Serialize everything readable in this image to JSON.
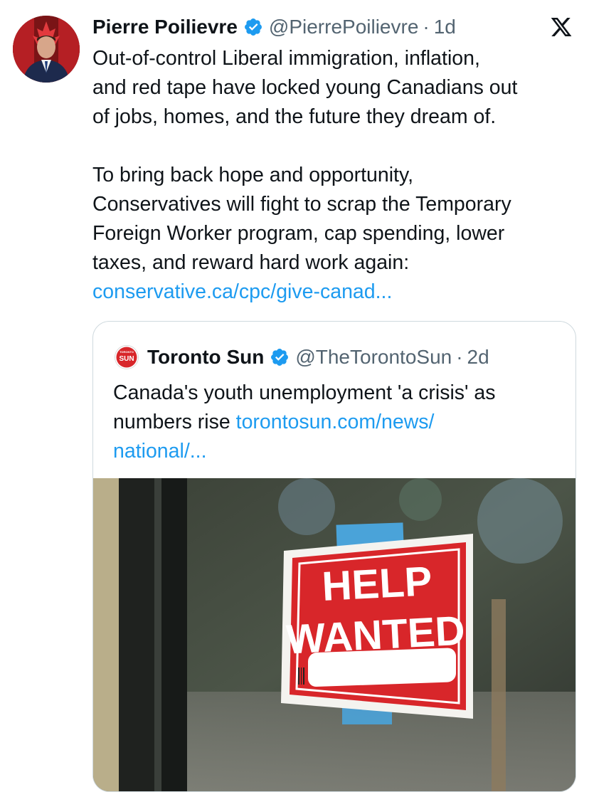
{
  "tweet": {
    "author_name": "Pierre Poilievre",
    "handle": "@PierrePoilievre",
    "separator": "·",
    "time": "1d",
    "body_lines": [
      "Out-of-control Liberal immigration, inflation,",
      "and red tape have locked young Canadians out",
      "of jobs, homes, and the future they dream of."
    ],
    "body_lines_2": [
      "To bring back hope and opportunity,",
      "Conservatives will fight to scrap the Temporary",
      "Foreign Worker program, cap spending, lower",
      "taxes, and reward hard work again:"
    ],
    "link": "conservative.ca/cpc/give-canad..."
  },
  "quoted_tweet": {
    "author_name": "Toronto Sun",
    "handle": "@TheTorontoSun",
    "separator": "·",
    "time": "2d",
    "text_line1": "Canada's youth unemployment 'a crisis' as",
    "text_line2_prefix": "numbers rise ",
    "link_part1": "torontosun.com/news/",
    "link_part2": "national/...",
    "logo_text": "SUN",
    "logo_small_text": "TORONTO"
  },
  "image": {
    "sign_line1": "HELP",
    "sign_line2": "WANTED"
  },
  "colors": {
    "link": "#1d9bf0",
    "verified": "#1d9bf0",
    "secondary_text": "#536471",
    "sign_red": "#d8262a"
  },
  "icons": {
    "verified": "verified-badge-icon",
    "platform": "x-logo-icon"
  }
}
